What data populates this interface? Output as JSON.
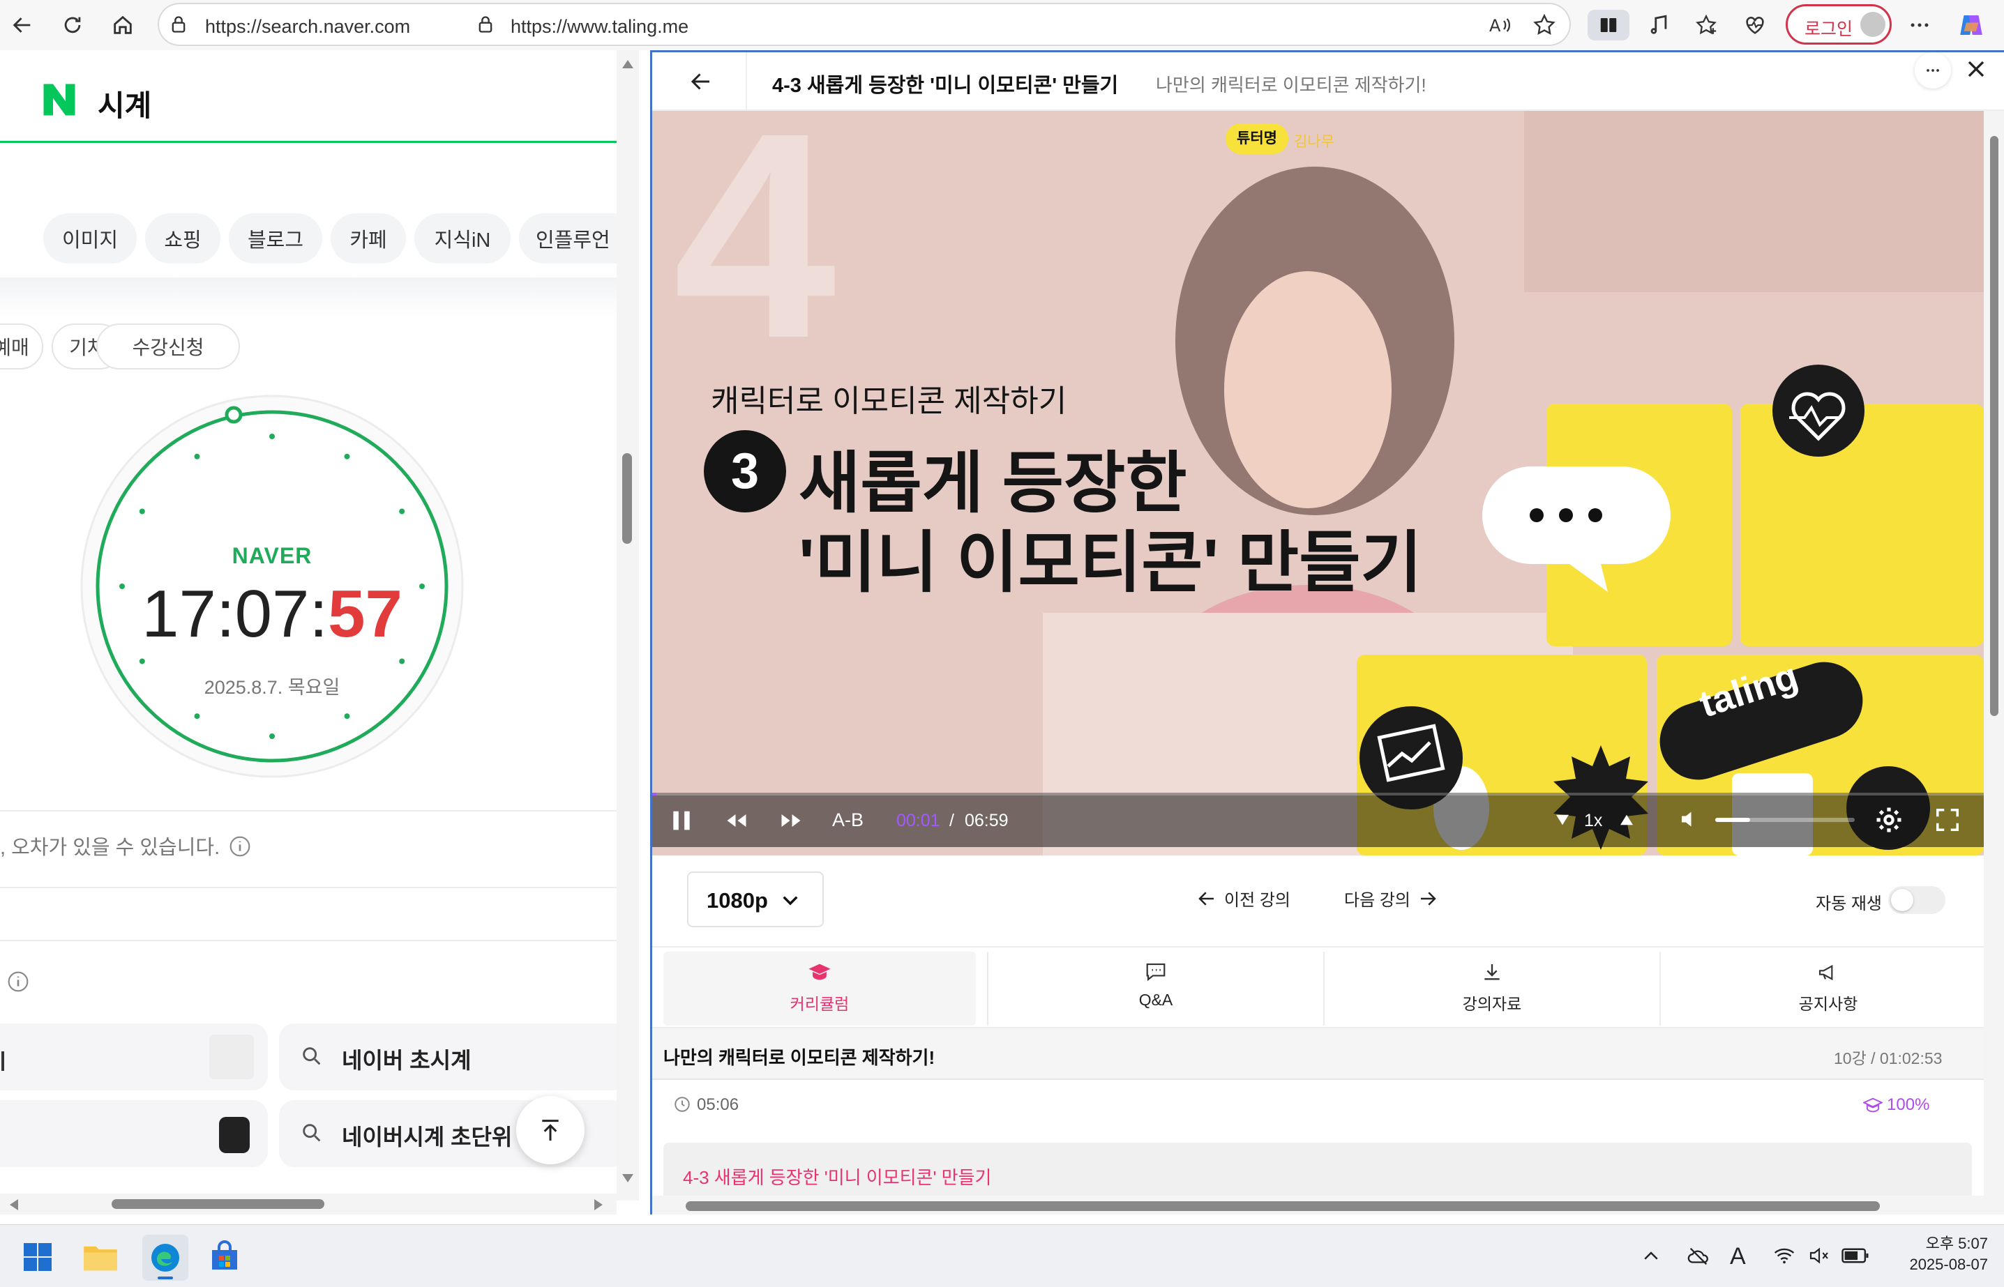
{
  "browser": {
    "left_url": "https://search.naver.com",
    "right_url": "https://www.taling.me",
    "login_label": "로그인"
  },
  "naver": {
    "title": "시계",
    "tabs": [
      "이미지",
      "쇼핑",
      "블로그",
      "카페",
      "지식iN",
      "인플루언"
    ],
    "chips": [
      "예매",
      "기차",
      "수강신청"
    ],
    "clock_brand": "NAVER",
    "clock_time_hm": "17:07:",
    "clock_time_s": "57",
    "clock_date": "2025.8.7. 목요일",
    "notice": ", 오차가 있을 수 있습니다.",
    "suggest_1": "네이버 초시계",
    "suggest_1_bold": "초",
    "suggest_2": "네이버시계 초단위"
  },
  "taling": {
    "lesson_title": "4-3 새롭게 등장한 '미니 이모티콘' 만들기",
    "course_subtitle": "나만의 캐릭터로 이모티콘 제작하기!",
    "video": {
      "tutor_badge": "튜터명",
      "tutor_name": "김나무",
      "big_number": "4",
      "caption_small": "캐릭터로 이모티콘 제작하기",
      "step_number": "3",
      "caption_line1": "새롭게 등장한",
      "caption_line2": "'미니 이모티콘' 만들기",
      "sticker_text": "taling"
    },
    "controls": {
      "ab_label": "A-B",
      "current_time": "00:01",
      "separator": "/",
      "duration": "06:59",
      "speed": "1x",
      "progress": 0.003,
      "volume": 0.25
    },
    "quality": "1080p",
    "prev_label": "이전 강의",
    "next_label": "다음 강의",
    "autoplay_label": "자동 재생",
    "autoplay_on": false,
    "tabs": [
      "커리큘럼",
      "Q&A",
      "강의자료",
      "공지사항"
    ],
    "active_tab": "커리큘럼",
    "course_title": "나만의 캐릭터로 이모티콘 제작하기!",
    "course_meta": "10강 / 01:02:53",
    "prev_item_duration": "05:06",
    "prev_item_progress": "100%",
    "current_item": "4-3 새롭게 등장한 '미니 이모티콘' 만들기"
  },
  "taskbar": {
    "ampm_time": "오후 5:07",
    "date": "2025-08-07"
  },
  "colors": {
    "naver_green": "#03c75a",
    "taling_accent": "#e8336f",
    "clock_red": "#e23b3b",
    "video_yellow": "#f8e13a",
    "edge_blue": "#4472c4"
  }
}
